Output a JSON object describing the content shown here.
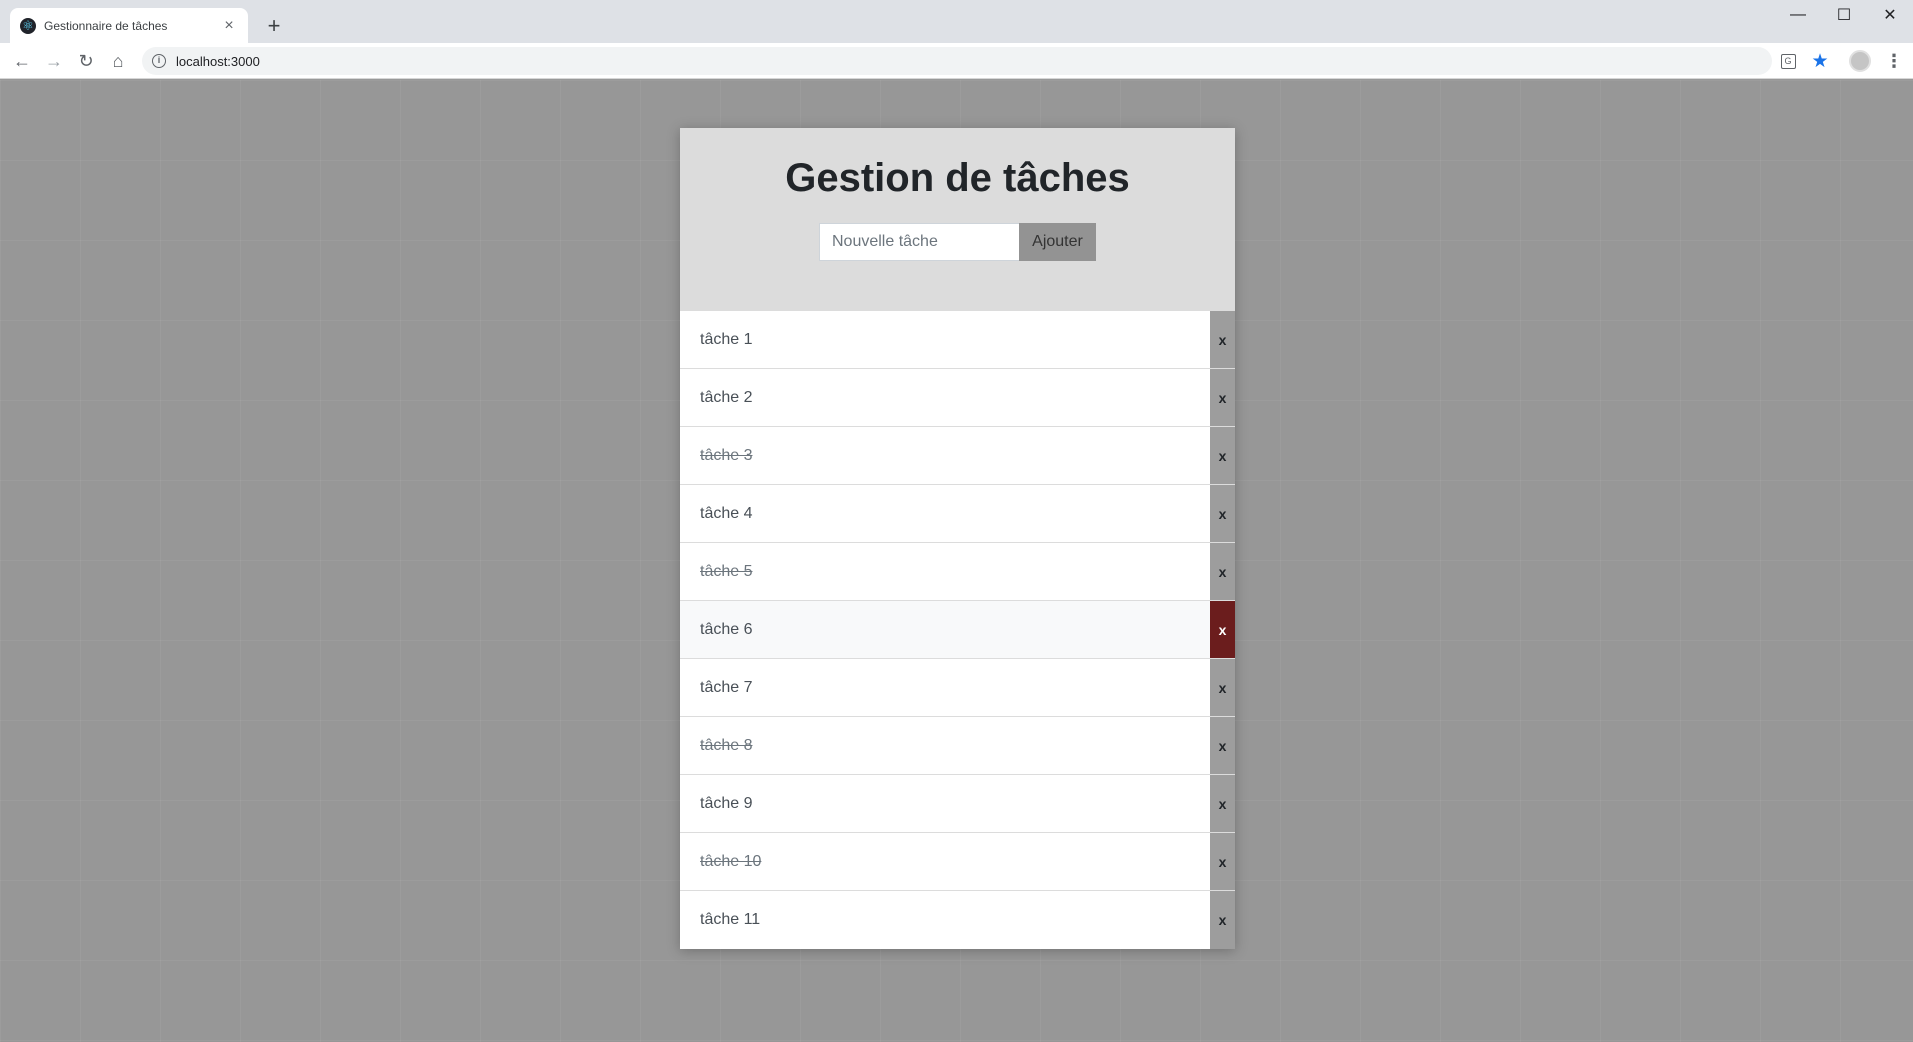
{
  "browser": {
    "tab_title": "Gestionnaire de tâches",
    "url": "localhost:3000",
    "icons": [
      "react-icon",
      "close-icon",
      "plus-icon",
      "back-icon",
      "forward-icon",
      "reload-icon",
      "home-icon",
      "info-icon",
      "translate-icon",
      "star-icon",
      "avatar-icon",
      "menu-icon",
      "minimize-icon",
      "maximize-icon",
      "window-close-icon"
    ]
  },
  "app": {
    "title": "Gestion de tâches",
    "input_placeholder": "Nouvelle tâche",
    "add_label": "Ajouter",
    "delete_label": "x",
    "tasks": [
      {
        "label": "tâche 1",
        "done": false
      },
      {
        "label": "tâche 2",
        "done": false
      },
      {
        "label": "tâche 3",
        "done": true
      },
      {
        "label": "tâche 4",
        "done": false
      },
      {
        "label": "tâche 5",
        "done": true
      },
      {
        "label": "tâche 6",
        "done": false,
        "hovered": true
      },
      {
        "label": "tâche 7",
        "done": false
      },
      {
        "label": "tâche 8",
        "done": true
      },
      {
        "label": "tâche 9",
        "done": false
      },
      {
        "label": "tâche 10",
        "done": true
      },
      {
        "label": "tâche 11",
        "done": false
      }
    ]
  },
  "colors": {
    "page_background": "#979797",
    "header_background": "#dcdcdc",
    "delete_active": "#6b1d1d",
    "star": "#1a73e8"
  }
}
